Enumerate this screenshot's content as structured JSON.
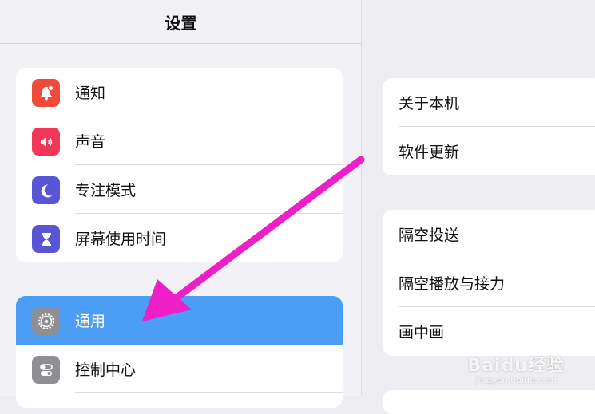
{
  "header": {
    "title": "设置"
  },
  "sidebar": {
    "groups": [
      {
        "items": [
          {
            "label": "通知",
            "icon": "bell-icon",
            "color": "#f04b3a"
          },
          {
            "label": "声音",
            "icon": "speaker-icon",
            "color": "#f2365a"
          },
          {
            "label": "专注模式",
            "icon": "moon-icon",
            "color": "#5856d6"
          },
          {
            "label": "屏幕使用时间",
            "icon": "hourglass-icon",
            "color": "#5856d6"
          }
        ]
      },
      {
        "items": [
          {
            "label": "通用",
            "icon": "gear-icon",
            "color": "#8e8e93",
            "selected": true
          },
          {
            "label": "控制中心",
            "icon": "toggle-icon",
            "color": "#8e8e93"
          }
        ]
      }
    ]
  },
  "detail": {
    "groups": [
      {
        "items": [
          {
            "label": "关于本机"
          },
          {
            "label": "软件更新"
          }
        ]
      },
      {
        "items": [
          {
            "label": "隔空投送"
          },
          {
            "label": "隔空播放与接力"
          },
          {
            "label": "画中画"
          }
        ]
      }
    ]
  },
  "annotation": {
    "arrow_color": "#ee1fc6"
  },
  "watermark": {
    "brand": "Baidu经验",
    "url": "jingyan.baidu.com"
  }
}
